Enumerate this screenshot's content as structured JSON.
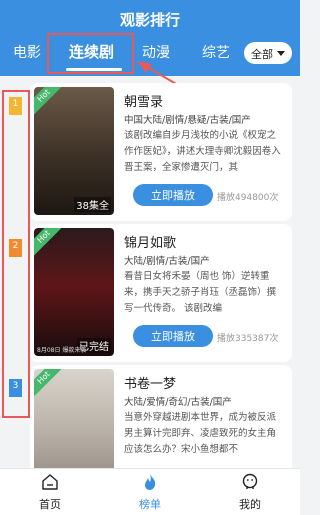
{
  "header": {
    "title": "观影排行"
  },
  "tabs": [
    {
      "label": "电影"
    },
    {
      "label": "连续剧"
    },
    {
      "label": "动漫"
    },
    {
      "label": "综艺"
    }
  ],
  "filter": {
    "selected": "全部"
  },
  "list": [
    {
      "rank": "1",
      "badge": "Hot",
      "title": "朝雪录",
      "genre": "中国大陆/剧情/悬疑/古装/国产",
      "desc": "该剧改编自步月浅妆的小说《权宠之作作医妃》，讲述大理寺卿沈毅因卷入晋王案，全家惨遭灭门，其",
      "episodes": "38集全",
      "play_label": "立即播放",
      "plays": "播放494800次"
    },
    {
      "rank": "2",
      "badge": "Hot",
      "title": "锦月如歌",
      "genre": "大陆/剧情/古装/国产",
      "desc": "看昔日女将禾晏（周也 饰）逆转重来，携手天之骄子肖珏（丞磊饰）撰写一代传奇。 该剧改编",
      "episodes": "已完结",
      "poster_note": "8月08日 爆款来袭",
      "play_label": "立即播放",
      "plays": "播放335387次"
    },
    {
      "rank": "3",
      "badge": "Hot",
      "title": "书卷一梦",
      "genre": "大陆/爱情/奇幻/古装/国产",
      "desc": "当意外穿越进剧本世界，成为被反派男主算计完即弃、凌虐致死的女主角应该怎么办？宋小鱼想都不",
      "episodes": "",
      "play_label": "立即播放",
      "plays": ""
    }
  ],
  "bottom_nav": [
    {
      "label": "首页",
      "icon": "home-icon"
    },
    {
      "label": "榜单",
      "icon": "flame-icon"
    },
    {
      "label": "我的",
      "icon": "user-icon"
    }
  ],
  "colors": {
    "primary": "#3a8fe0",
    "hot": "#45b86b",
    "annotation": "#e85a5a",
    "rank1": "#f2b632",
    "rank2": "#f28b30",
    "rank3": "#3a8fe0"
  }
}
